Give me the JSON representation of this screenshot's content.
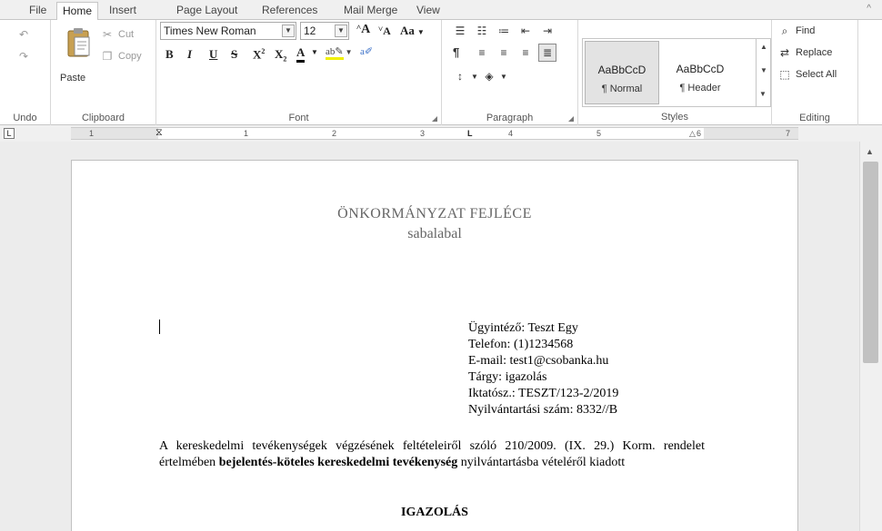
{
  "tabs": [
    {
      "label": "File",
      "active": false
    },
    {
      "label": "Home",
      "active": true
    },
    {
      "label": "Insert",
      "active": false
    },
    {
      "label": "Page Layout",
      "active": false
    },
    {
      "label": "References",
      "active": false
    },
    {
      "label": "Mail Merge",
      "active": false
    },
    {
      "label": "View",
      "active": false
    }
  ],
  "ribbon": {
    "undo": {
      "label": "Undo"
    },
    "clipboard": {
      "paste": "Paste",
      "cut": "Cut",
      "copy": "Copy",
      "label": "Clipboard"
    },
    "font": {
      "family": "Times New Roman",
      "size": "12",
      "grow": "A",
      "shrink": "A",
      "case": "Aa",
      "bold": "B",
      "italic": "I",
      "underline": "U",
      "strike": "S",
      "superscript": "X",
      "subscript": "X",
      "font_color": "A",
      "label": "Font"
    },
    "paragraph": {
      "pilcrow": "¶",
      "label": "Paragraph"
    },
    "styles": {
      "items": [
        {
          "sample": "AaBbCcD",
          "name": "¶ Normal",
          "selected": true
        },
        {
          "sample": "AaBbCcD",
          "name": "¶ Header",
          "selected": false
        }
      ],
      "label": "Styles"
    },
    "editing": {
      "find": "Find",
      "replace": "Replace",
      "select_all": "Select All",
      "label": "Editing"
    }
  },
  "ruler": {
    "numbers": [
      "1",
      "1",
      "2",
      "3",
      "4",
      "5",
      "6",
      "7"
    ]
  },
  "document": {
    "header_title": "ÖNKORMÁNYZAT FEJLÉCE",
    "header_subtitle": "sabalabal",
    "info": [
      "Ügyintéző: Teszt Egy",
      "Telefon: (1)1234568",
      "E-mail: test1@csobanka.hu",
      "Tárgy: igazolás",
      "Iktatósz.: TESZT/123-2/2019",
      "Nyilvántartási szám: 8332//B"
    ],
    "para_before": "A kereskedelmi tevékenységek végzésének feltételeiről szóló 210/2009. (IX. 29.) Korm. rendelet értelmében ",
    "para_bold": "bejelentés-köteles kereskedelmi tevékenység",
    "para_after": " nyilvántartásba vételéről kiadott",
    "heading": "IGAZOLÁS"
  }
}
